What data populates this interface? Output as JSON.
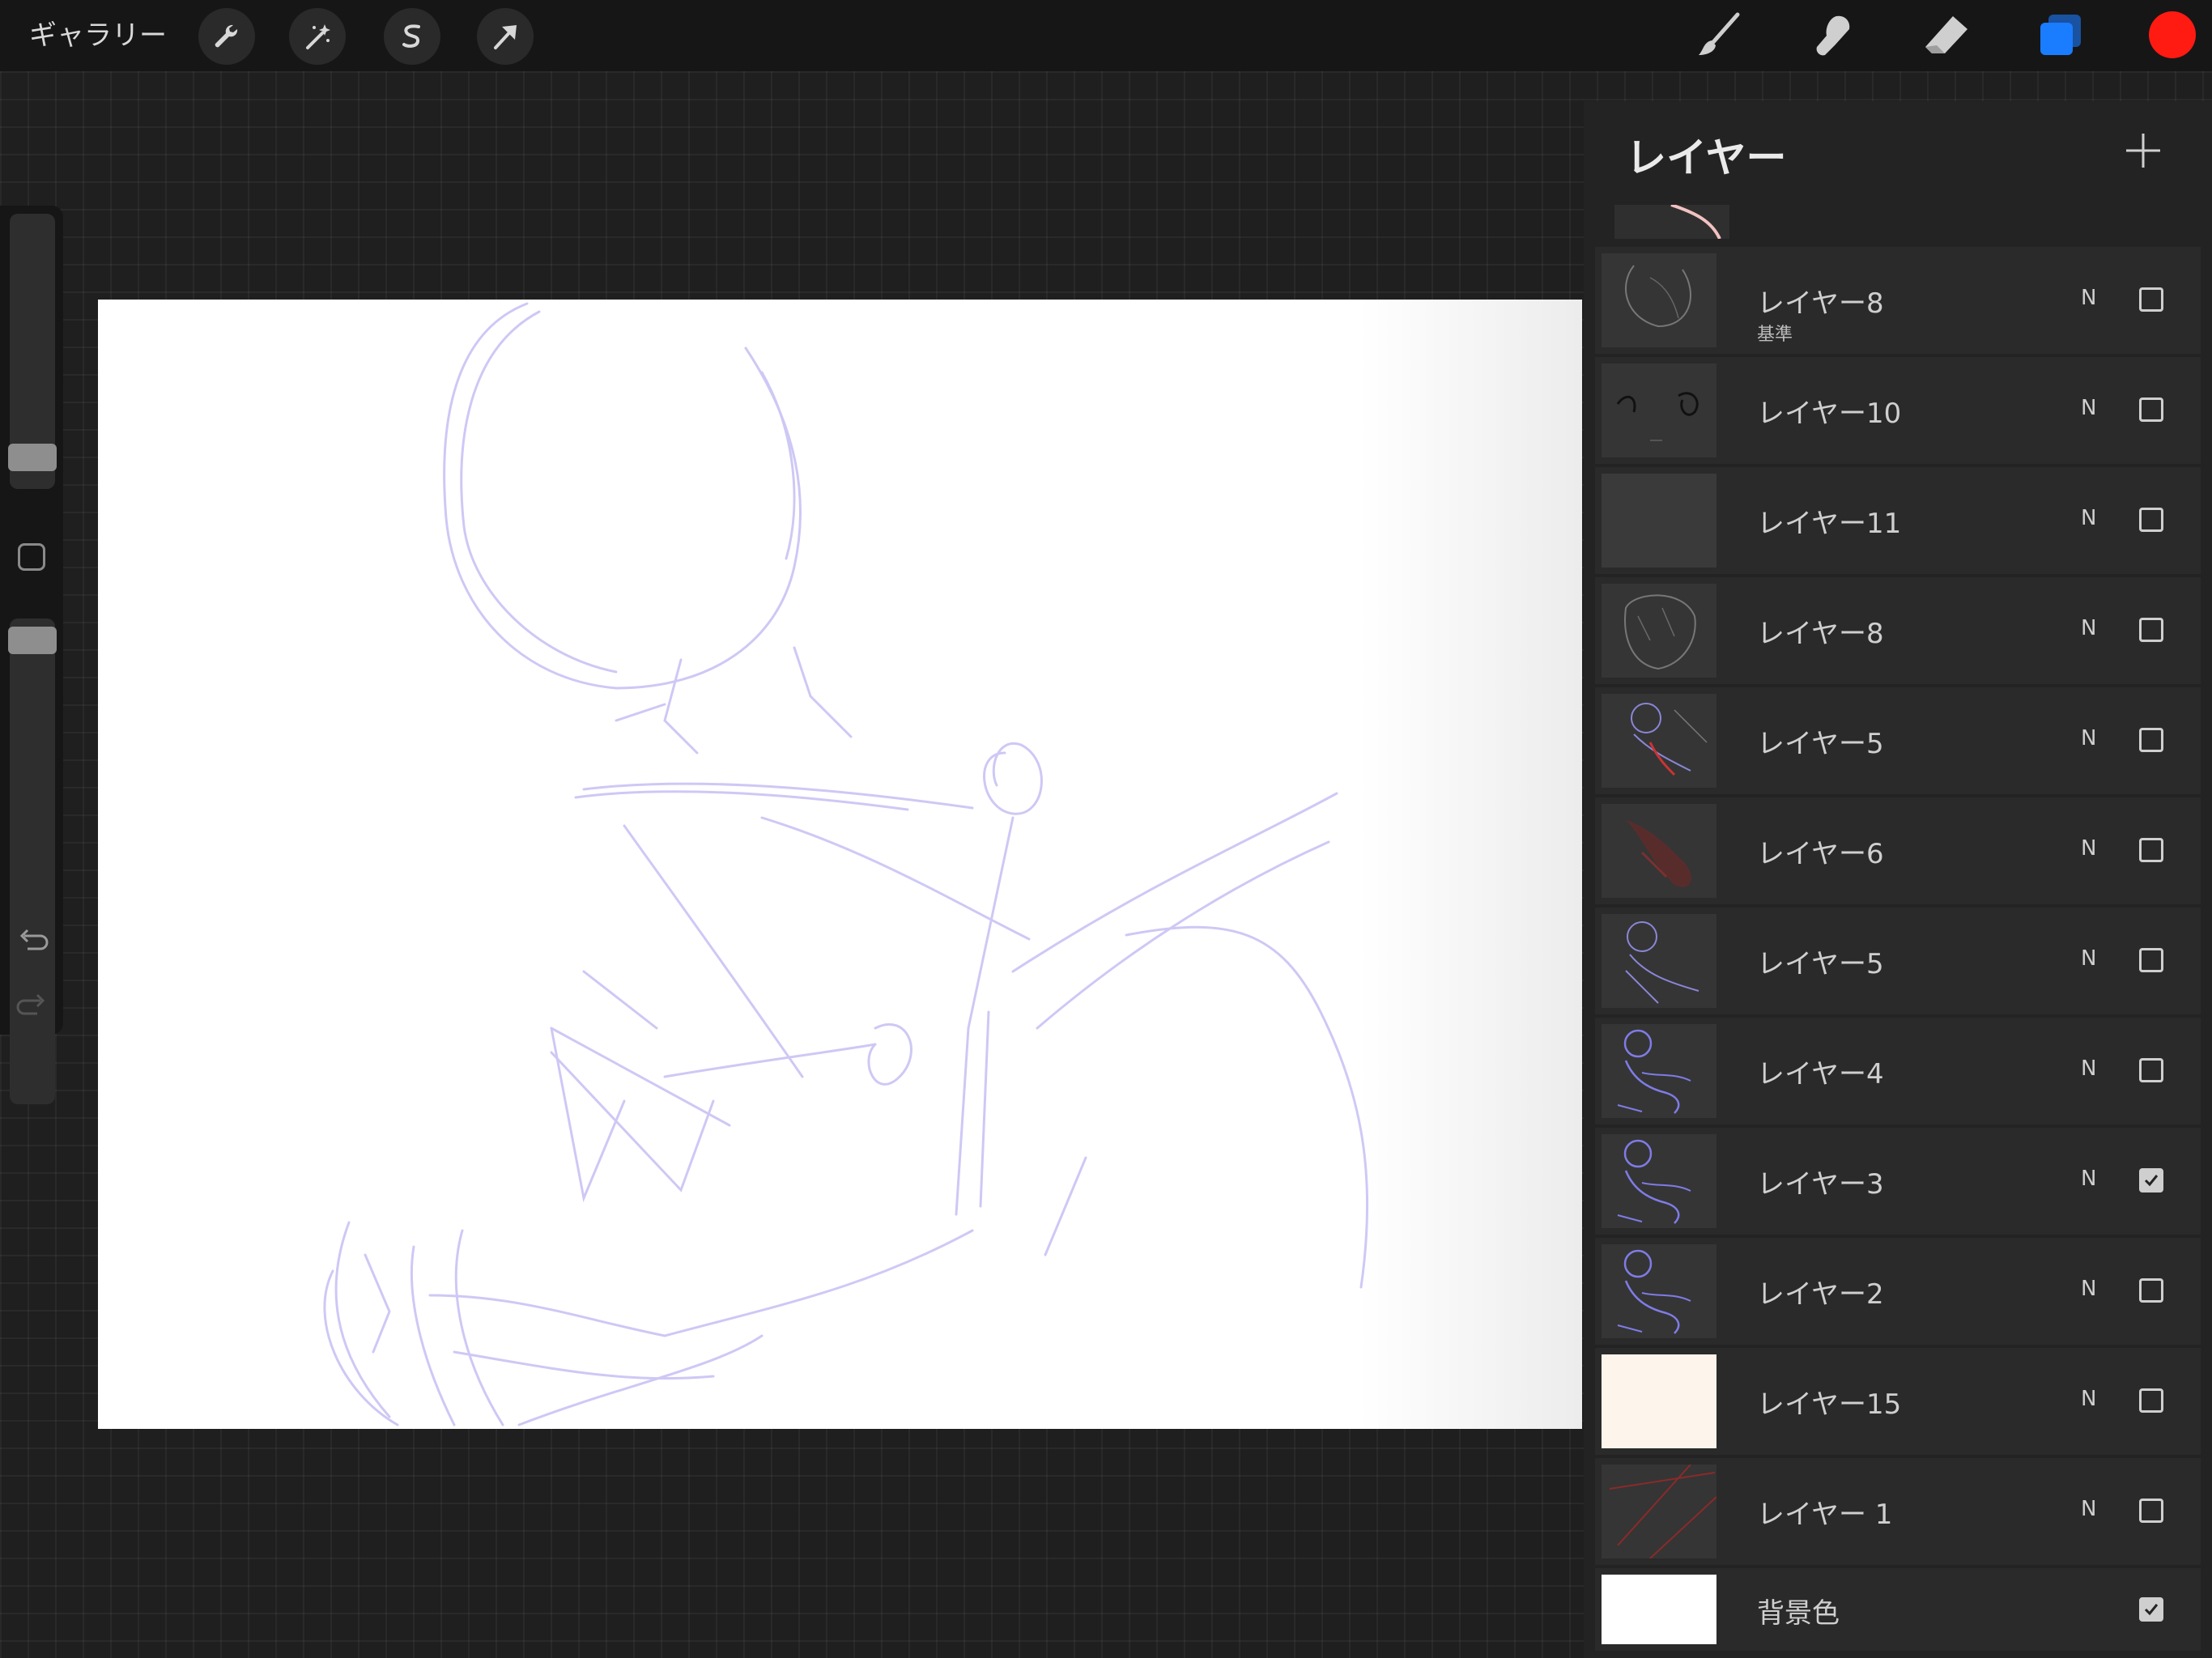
{
  "topbar": {
    "gallery_label": "ギャラリー",
    "active_color": "#ff1a12",
    "layers_accent": "#1a7cff"
  },
  "layers_panel": {
    "title": "レイヤー",
    "layers": [
      {
        "name": "レイヤー8",
        "sub": "基準",
        "mode": "N",
        "visible": false,
        "thumb": "sketch-face"
      },
      {
        "name": "レイヤー10",
        "sub": "",
        "mode": "N",
        "visible": false,
        "thumb": "eyes"
      },
      {
        "name": "レイヤー11",
        "sub": "",
        "mode": "N",
        "visible": false,
        "thumb": "blank"
      },
      {
        "name": "レイヤー8",
        "sub": "",
        "mode": "N",
        "visible": false,
        "thumb": "hair"
      },
      {
        "name": "レイヤー5",
        "sub": "",
        "mode": "N",
        "visible": false,
        "thumb": "figure-red"
      },
      {
        "name": "レイヤー6",
        "sub": "",
        "mode": "N",
        "visible": false,
        "thumb": "red-shade"
      },
      {
        "name": "レイヤー5",
        "sub": "",
        "mode": "N",
        "visible": false,
        "thumb": "figure-purple"
      },
      {
        "name": "レイヤー4",
        "sub": "",
        "mode": "N",
        "visible": false,
        "thumb": "figure-blue"
      },
      {
        "name": "レイヤー3",
        "sub": "",
        "mode": "N",
        "visible": true,
        "thumb": "figure-blue"
      },
      {
        "name": "レイヤー2",
        "sub": "",
        "mode": "N",
        "visible": false,
        "thumb": "figure-blue"
      },
      {
        "name": "レイヤー15",
        "sub": "",
        "mode": "N",
        "visible": false,
        "thumb": "cream"
      },
      {
        "name": "レイヤー 1",
        "sub": "",
        "mode": "N",
        "visible": false,
        "thumb": "lines-red"
      },
      {
        "name": "背景色",
        "sub": "",
        "mode": "",
        "visible": true,
        "thumb": "white"
      }
    ]
  }
}
